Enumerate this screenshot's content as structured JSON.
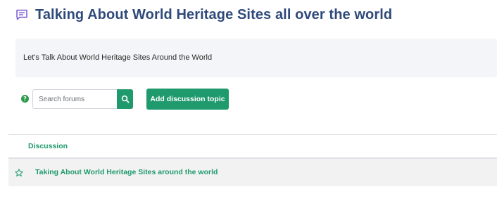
{
  "header": {
    "icon": "forum-icon",
    "title": "Talking About World Heritage Sites all over the world"
  },
  "intro": {
    "text": "Let's Talk About World Heritage Sites Around the World"
  },
  "toolbar": {
    "help_icon": "help-icon",
    "help_glyph": "?",
    "search_placeholder": "Search forums",
    "search_value": "",
    "search_icon": "search-icon",
    "add_button_label": "Add discussion topic"
  },
  "table": {
    "columns": [
      "Discussion"
    ],
    "rows": [
      {
        "star_icon": "star-outline-icon",
        "title": "Taking About World Heritage Sites around the world"
      }
    ]
  },
  "colors": {
    "title": "#2f4a7a",
    "accent": "#1f9a6d",
    "icon_purple": "#7a5cd6",
    "intro_bg": "#f3f5f8",
    "row_bg": "#f2f2f2"
  }
}
